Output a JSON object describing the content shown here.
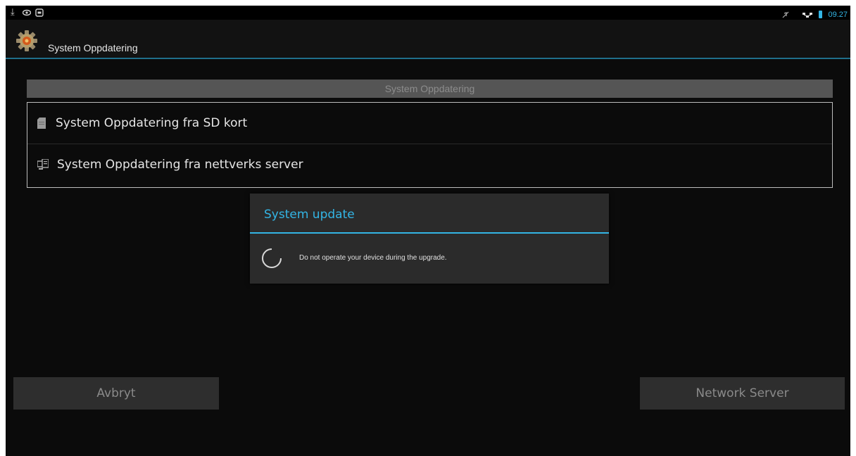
{
  "status_bar": {
    "left_icons": [
      "download-icon",
      "eye-icon",
      "screen-icon"
    ],
    "right_icons": [
      "mute-icon",
      "network-icon",
      "battery-icon"
    ],
    "clock": "09.27",
    "accent_color": "#33b5e5"
  },
  "action_bar": {
    "title": "System Oppdatering",
    "icon": "gear-icon"
  },
  "section": {
    "header": "System Oppdatering",
    "items": [
      {
        "label": "System Oppdatering fra SD kort",
        "icon": "sd-card-icon"
      },
      {
        "label": "System Oppdatering fra nettverks server",
        "icon": "network-server-icon"
      }
    ]
  },
  "dialog": {
    "title": "System update",
    "message": "Do not operate your device during the upgrade."
  },
  "buttons": {
    "cancel_label": "Avbryt",
    "network_label": "Network Server"
  }
}
